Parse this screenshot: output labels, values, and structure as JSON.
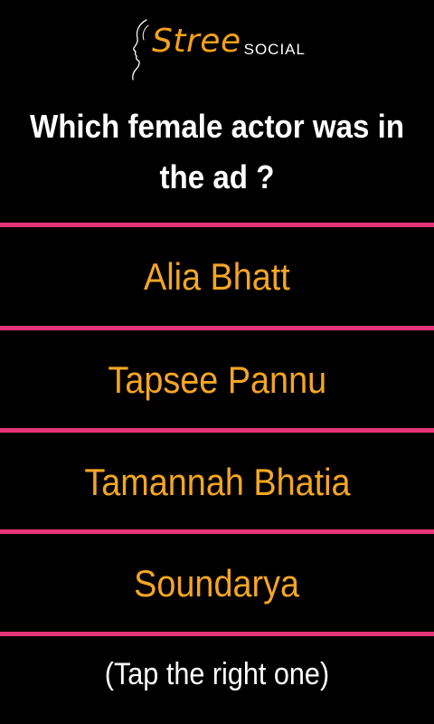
{
  "brand": {
    "name_primary": "Stree",
    "name_secondary": "SOCIAL",
    "logo_icon": "woman-profile-icon",
    "accent_color": "#f5a11a"
  },
  "question": {
    "text": "Which female actor was in the ad ?"
  },
  "options": [
    {
      "label": "Alia Bhatt"
    },
    {
      "label": "Tapsee Pannu"
    },
    {
      "label": "Tamannah Bhatia"
    },
    {
      "label": "Soundarya"
    }
  ],
  "hint": {
    "text": "(Tap the right one)"
  },
  "colors": {
    "background": "#000000",
    "divider": "#e8357a",
    "option_text": "#f5a623",
    "question_text": "#ffffff"
  }
}
